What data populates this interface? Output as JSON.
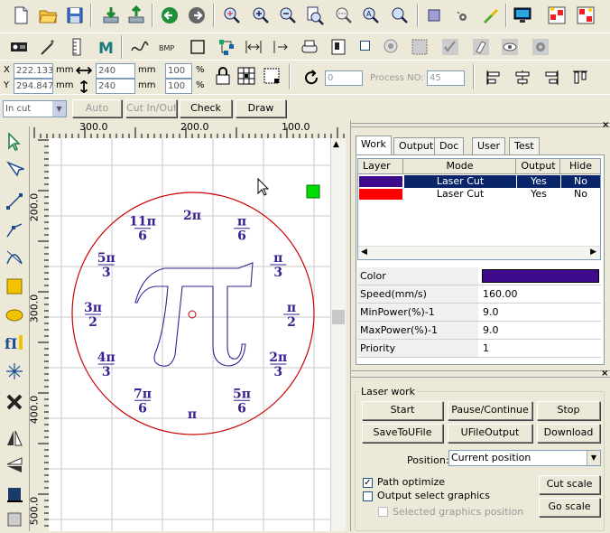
{
  "coords": {
    "x_label": "X",
    "y_label": "Y",
    "x_value": "222.133",
    "y_value": "294.847",
    "x_unit": "mm",
    "y_unit": "mm",
    "width_value": "240",
    "height_value": "240",
    "width_unit": "mm",
    "height_unit": "mm",
    "scale_x": "100",
    "scale_y": "100",
    "scale_x_unit": "%",
    "scale_y_unit": "%",
    "rotate_value": "0",
    "process_label": "Process NO:",
    "process_value": "45"
  },
  "cut_toolbar": {
    "mode_select": "In cut",
    "auto": "Auto",
    "cut_in_out": "Cut In/Out",
    "check": "Check",
    "draw": "Draw"
  },
  "ruler": {
    "top_ticks": [
      "300.0",
      "200.0",
      "100.0"
    ],
    "left_ticks": [
      "200.0",
      "300.0",
      "400.0",
      "500.0"
    ]
  },
  "drawing": {
    "labels": [
      {
        "num": "2π",
        "den": ""
      },
      {
        "num": "π",
        "den": "6"
      },
      {
        "num": "π",
        "den": "3"
      },
      {
        "num": "π",
        "den": "2"
      },
      {
        "num": "2π",
        "den": "3"
      },
      {
        "num": "5π",
        "den": "6"
      },
      {
        "num": "π",
        "den": ""
      },
      {
        "num": "7π",
        "den": "6"
      },
      {
        "num": "4π",
        "den": "3"
      },
      {
        "num": "3π",
        "den": "2"
      },
      {
        "num": "5π",
        "den": "3"
      },
      {
        "num": "11π",
        "den": "6"
      }
    ],
    "center_glyph": "π",
    "circle_color": "#cc0000",
    "glyph_color": "#3a2090"
  },
  "tabs": [
    "Work",
    "Output",
    "Doc",
    "User",
    "Test"
  ],
  "layers": {
    "headers": [
      "Layer",
      "Mode",
      "Output",
      "Hide"
    ],
    "rows": [
      {
        "color": "#3c0a8a",
        "mode": "Laser Cut",
        "output": "Yes",
        "hide": "No",
        "selected": true
      },
      {
        "color": "#ff0000",
        "mode": "Laser Cut",
        "output": "Yes",
        "hide": "No",
        "selected": false
      }
    ]
  },
  "properties": {
    "color_label": "Color",
    "color_value": "#3c0a8a",
    "speed_label": "Speed(mm/s)",
    "speed_value": "160.00",
    "minpower_label": "MinPower(%)-1",
    "minpower_value": "9.0",
    "maxpower_label": "MaxPower(%)-1",
    "maxpower_value": "9.0",
    "priority_label": "Priority",
    "priority_value": "1"
  },
  "laser_work": {
    "title": "Laser work",
    "start": "Start",
    "pause": "Pause/Continue",
    "stop": "Stop",
    "save_to_ufile": "SaveToUFile",
    "ufile_output": "UFileOutput",
    "download": "Download",
    "position_label": "Position:",
    "position_value": "Current position",
    "path_optimize": "Path optimize",
    "output_select": "Output select graphics",
    "selected_graphics": "Selected graphics position",
    "cut_scale": "Cut scale",
    "go_scale": "Go scale"
  },
  "icons": [
    "new-icon",
    "open-icon",
    "save-icon",
    "import-icon",
    "export-icon",
    "undo-icon",
    "redo-icon",
    "zoom-icon",
    "zoom-in-icon",
    "zoom-out-icon",
    "zoom-page-icon",
    "zoom-select-icon",
    "zoom-all-icon",
    "zoom-reset-icon",
    "frame-icon",
    "stamp-icon",
    "paint-icon",
    "monitor-icon",
    "align-icon",
    "distribute-icon"
  ],
  "colors": {
    "accent": "#0a246a",
    "green_marker": "#00dd00"
  }
}
